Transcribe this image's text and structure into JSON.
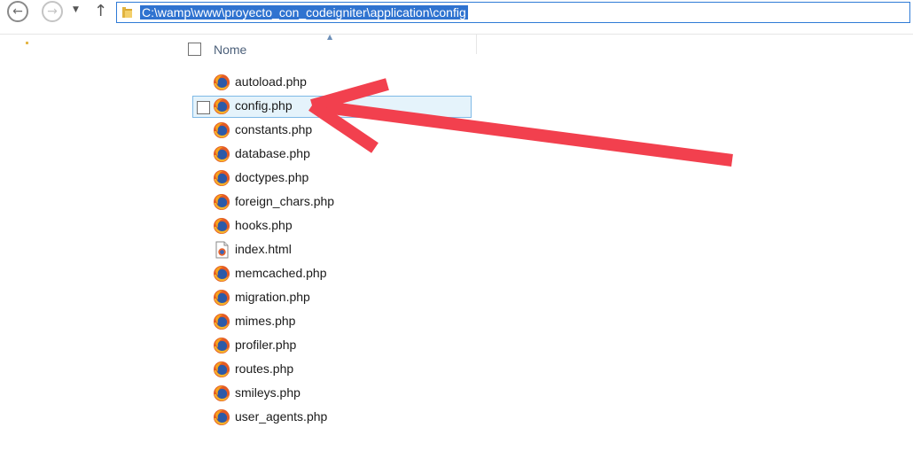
{
  "address_bar": {
    "path": "C:\\wamp\\www\\proyecto_con_codeigniter\\application\\config"
  },
  "nav": {
    "back_icon": "back-arrow-icon",
    "forward_icon": "forward-arrow-icon",
    "up_icon": "up-arrow-icon"
  },
  "column_header": {
    "name_label": "Nome"
  },
  "files": [
    {
      "name": "autoload.php",
      "icon": "firefox-icon"
    },
    {
      "name": "config.php",
      "icon": "firefox-icon",
      "selected": true
    },
    {
      "name": "constants.php",
      "icon": "firefox-icon"
    },
    {
      "name": "database.php",
      "icon": "firefox-icon"
    },
    {
      "name": "doctypes.php",
      "icon": "firefox-icon"
    },
    {
      "name": "foreign_chars.php",
      "icon": "firefox-icon"
    },
    {
      "name": "hooks.php",
      "icon": "firefox-icon"
    },
    {
      "name": "index.html",
      "icon": "html-document-icon"
    },
    {
      "name": "memcached.php",
      "icon": "firefox-icon"
    },
    {
      "name": "migration.php",
      "icon": "firefox-icon"
    },
    {
      "name": "mimes.php",
      "icon": "firefox-icon"
    },
    {
      "name": "profiler.php",
      "icon": "firefox-icon"
    },
    {
      "name": "routes.php",
      "icon": "firefox-icon"
    },
    {
      "name": "smileys.php",
      "icon": "firefox-icon"
    },
    {
      "name": "user_agents.php",
      "icon": "firefox-icon"
    }
  ],
  "colors": {
    "selection_bg": "#e5f3fb",
    "selection_border": "#7fb9e6",
    "address_highlight": "#2f73d0",
    "annotation_arrow": "#f2404e"
  }
}
